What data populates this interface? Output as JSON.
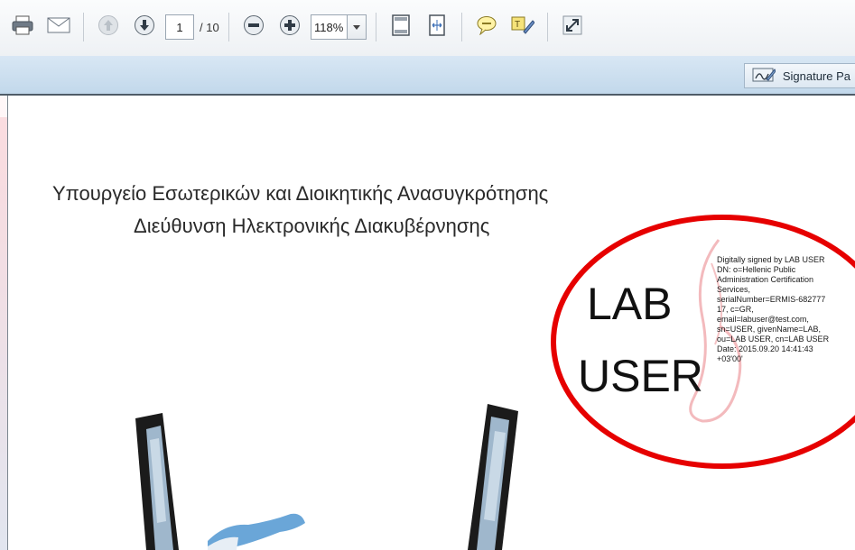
{
  "toolbar": {
    "page_current": "1",
    "page_total": "/ 10",
    "zoom": "118%"
  },
  "subbar": {
    "signature_panel_label": "Signature Pa"
  },
  "document": {
    "heading_line1": "Υπουργείο Εσωτερικών και Διοικητικής Ανασυγκρότησης",
    "heading_line2": "Διεύθυνση Ηλεκτρονικής Διακυβέρνησης"
  },
  "signature": {
    "name_line1": "LAB",
    "name_line2": "USER",
    "details": "Digitally signed by LAB USER\nDN: o=Hellenic Public\nAdministration Certification\nServices,\nserialNumber=ERMIS-682777\n17, c=GR,\nemail=labuser@test.com,\nsn=USER, givenName=LAB,\nou=LAB USER, cn=LAB USER\nDate: 2015.09.20 14:41:43\n+03'00'"
  },
  "colors": {
    "highlight_circle": "#e60000",
    "subbar": "#c9ddef"
  }
}
